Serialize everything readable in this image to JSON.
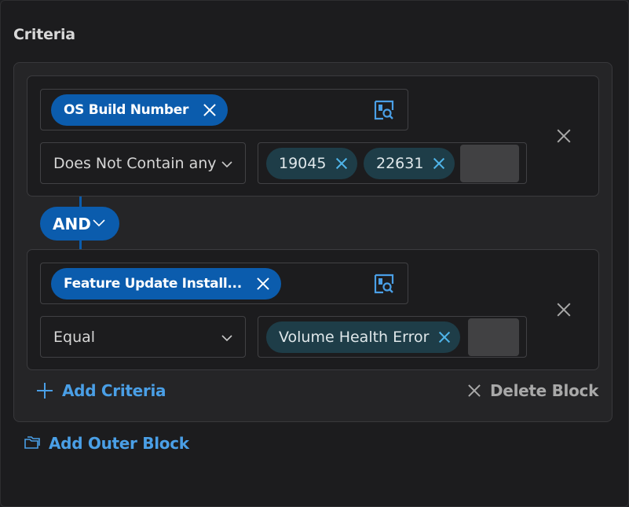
{
  "section": {
    "title": "Criteria"
  },
  "blocks": [
    {
      "field": "OS Build Number",
      "operator": "Does Not Contain any",
      "values": [
        "19045",
        "22631"
      ]
    },
    {
      "field": "Feature Update Install...",
      "operator": "Equal",
      "values": [
        "Volume Health Error"
      ]
    }
  ],
  "connector": {
    "label": "AND"
  },
  "actions": {
    "add_criteria": "Add Criteria",
    "delete_block": "Delete Block",
    "add_outer_block": "Add Outer Block"
  },
  "icons": {
    "field_picker": "field-picker-icon",
    "remove": "close-icon",
    "dropdown": "chevron-down-icon",
    "add": "plus-icon",
    "outer_block": "folder-icon"
  },
  "colors": {
    "accent": "#0b5cad",
    "link": "#4a9fe6",
    "value_chip": "#1e3d48",
    "background": "#1c1c1e"
  }
}
